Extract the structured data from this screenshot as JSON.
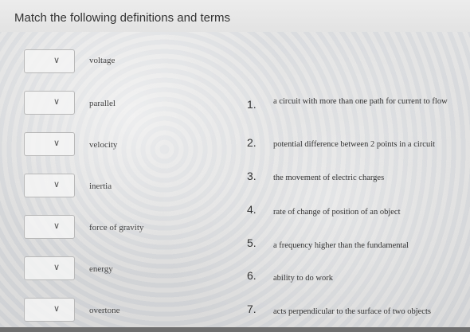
{
  "title": "Match the following definitions and terms",
  "dropdown_icon": "chevron-down-icon",
  "terms": [
    "voltage",
    "parallel",
    "velocity",
    "inertia",
    "force of gravity",
    "energy",
    "overtone"
  ],
  "definitions": [
    {
      "num": "1.",
      "text": "a circuit with more than one path for current to flow"
    },
    {
      "num": "2.",
      "text": "potential difference between 2 points in a circuit"
    },
    {
      "num": "3.",
      "text": "the movement of electric charges"
    },
    {
      "num": "4.",
      "text": "rate of change of position of an object"
    },
    {
      "num": "5.",
      "text": "a frequency higher than the fundamental"
    },
    {
      "num": "6.",
      "text": "ability to do work"
    },
    {
      "num": "7.",
      "text": "acts perpendicular to the surface of two objects"
    }
  ]
}
